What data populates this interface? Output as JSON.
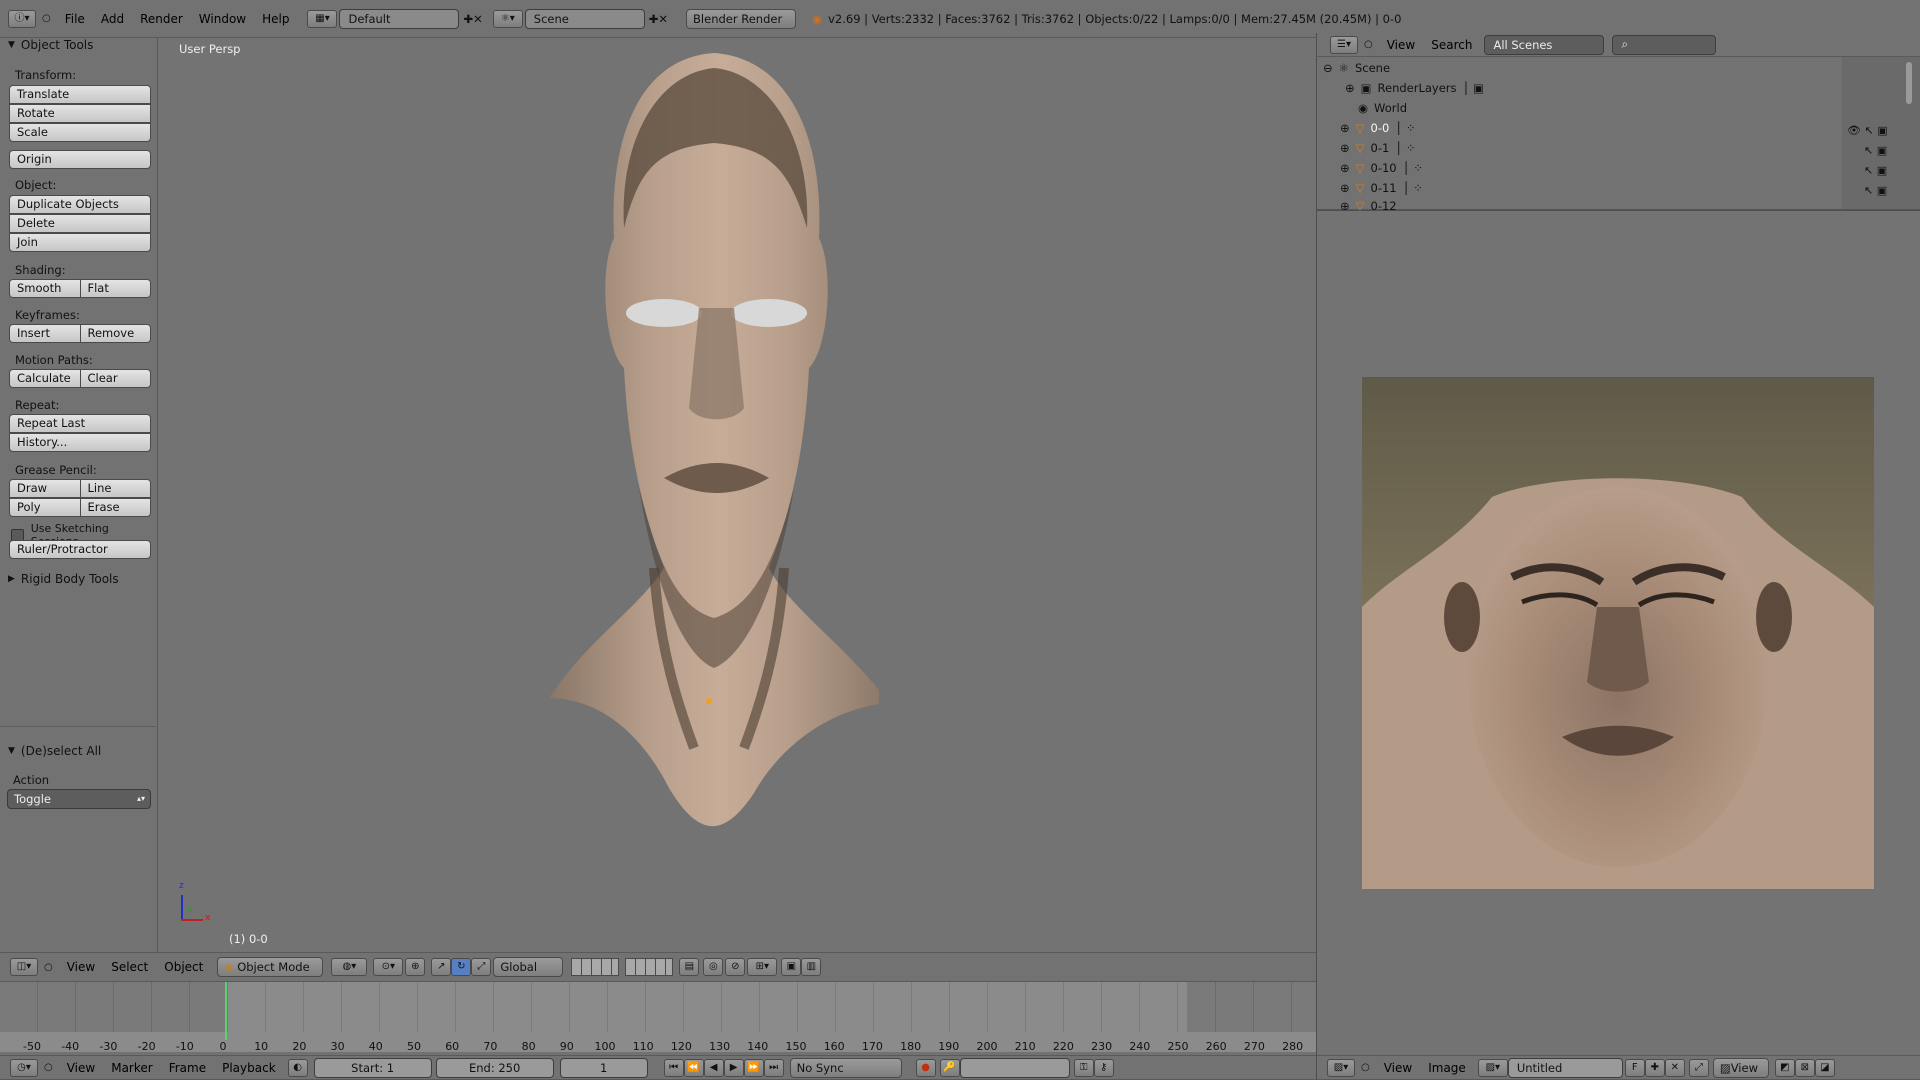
{
  "topbar": {
    "menus": [
      "File",
      "Add",
      "Render",
      "Window",
      "Help"
    ],
    "screen_layout": "Default",
    "scene": "Scene",
    "render_engine": "Blender Render",
    "stats": "v2.69 | Verts:2332 | Faces:3762 | Tris:3762 | Objects:0/22 | Lamps:0/0 | Mem:27.45M (20.45M) | 0-0"
  },
  "tool_shelf": {
    "title": "Object Tools",
    "transform_label": "Transform:",
    "translate": "Translate",
    "rotate": "Rotate",
    "scale": "Scale",
    "origin": "Origin",
    "object_label": "Object:",
    "duplicate": "Duplicate Objects",
    "delete": "Delete",
    "join": "Join",
    "shading_label": "Shading:",
    "smooth": "Smooth",
    "flat": "Flat",
    "keyframes_label": "Keyframes:",
    "insert": "Insert",
    "remove": "Remove",
    "motion_label": "Motion Paths:",
    "calculate": "Calculate",
    "clear": "Clear",
    "repeat_label": "Repeat:",
    "repeat_last": "Repeat Last",
    "history": "History...",
    "grease_label": "Grease Pencil:",
    "draw": "Draw",
    "line": "Line",
    "poly": "Poly",
    "erase": "Erase",
    "sketching": "Use Sketching Sessions",
    "ruler": "Ruler/Protractor",
    "rigid": "Rigid Body Tools",
    "deselect_title": "(De)select All",
    "action_label": "Action",
    "action_value": "Toggle"
  },
  "viewport": {
    "view_name": "User Persp",
    "object_info": "(1) 0-0",
    "axis_x": "x",
    "axis_y": "y",
    "axis_z": "z"
  },
  "viewport_header": {
    "view": "View",
    "select": "Select",
    "object": "Object",
    "mode": "Object Mode",
    "orientation": "Global"
  },
  "timeline": {
    "ticks": [
      "-50",
      "-40",
      "-30",
      "-20",
      "-10",
      "0",
      "10",
      "20",
      "30",
      "40",
      "50",
      "60",
      "70",
      "80",
      "90",
      "100",
      "110",
      "120",
      "130",
      "140",
      "150",
      "160",
      "170",
      "180",
      "190",
      "200",
      "210",
      "220",
      "230",
      "240",
      "250",
      "260",
      "270",
      "280"
    ],
    "menus": [
      "View",
      "Marker",
      "Frame",
      "Playback"
    ],
    "start": "Start: 1",
    "end": "End: 250",
    "current": "1",
    "sync": "No Sync"
  },
  "outliner": {
    "view": "View",
    "search": "Search",
    "filter": "All Scenes",
    "items": [
      "Scene",
      "RenderLayers",
      "World",
      "0-0",
      "0-1",
      "0-10",
      "0-11",
      "0-12"
    ]
  },
  "image_editor": {
    "view": "View",
    "image": "Image",
    "image_name": "Untitled",
    "fake_user": "F",
    "view_menu": "View"
  }
}
